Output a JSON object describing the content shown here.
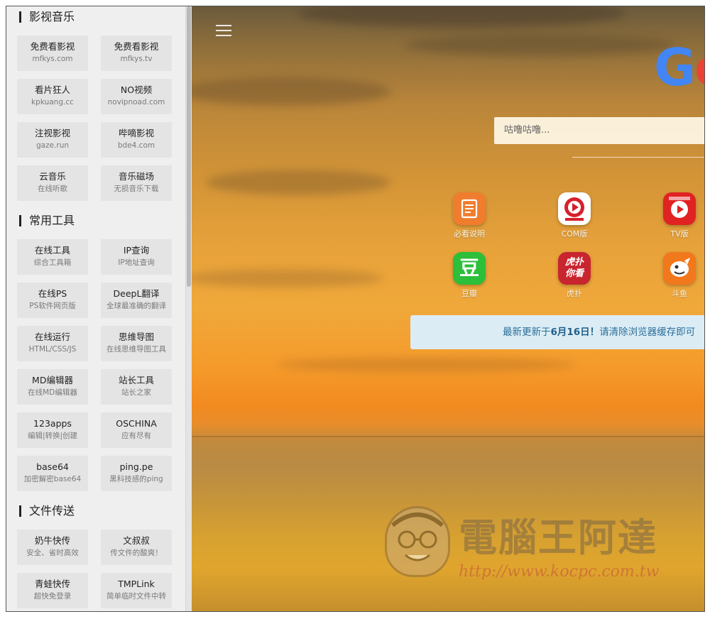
{
  "sidebar": {
    "sections": [
      {
        "title": "影视音乐",
        "items": [
          {
            "name": "免费看影视",
            "sub": "mfkys.com"
          },
          {
            "name": "免费看影视",
            "sub": "mfkys.tv"
          },
          {
            "name": "看片狂人",
            "sub": "kpkuang.cc"
          },
          {
            "name": "NO视频",
            "sub": "novipnoad.com"
          },
          {
            "name": "注视影视",
            "sub": "gaze.run"
          },
          {
            "name": "哔嘀影视",
            "sub": "bde4.com"
          },
          {
            "name": "云音乐",
            "sub": "在线听歌"
          },
          {
            "name": "音乐磁场",
            "sub": "无损音乐下载"
          }
        ]
      },
      {
        "title": "常用工具",
        "items": [
          {
            "name": "在线工具",
            "sub": "综合工具箱"
          },
          {
            "name": "IP查询",
            "sub": "IP地址查询"
          },
          {
            "name": "在线PS",
            "sub": "PS软件网页版"
          },
          {
            "name": "DeepL翻译",
            "sub": "全球最准确的翻译"
          },
          {
            "name": "在线运行",
            "sub": "HTML/CSS/JS"
          },
          {
            "name": "思维导图",
            "sub": "在线思维导图工具"
          },
          {
            "name": "MD编辑器",
            "sub": "在线MD编辑器"
          },
          {
            "name": "站长工具",
            "sub": "站长之家"
          },
          {
            "name": "123apps",
            "sub": "编辑|转换|创建"
          },
          {
            "name": "OSCHINA",
            "sub": "应有尽有"
          },
          {
            "name": "base64",
            "sub": "加密解密base64"
          },
          {
            "name": "ping.pe",
            "sub": "黑科技感的ping"
          }
        ]
      },
      {
        "title": "文件传送",
        "items": [
          {
            "name": "奶牛快传",
            "sub": "安全、省时高效"
          },
          {
            "name": "文叔叔",
            "sub": "传文件的酸爽！"
          },
          {
            "name": "青蛙快传",
            "sub": "超快免登录"
          },
          {
            "name": "TMPLink",
            "sub": "简单临时文件中转"
          }
        ]
      }
    ]
  },
  "main": {
    "logo_text": "Go",
    "search": {
      "placeholder": "咕噜咕噜..."
    },
    "apps": [
      {
        "label": "必看说明",
        "icon": "document-icon",
        "color": "#f07d2e"
      },
      {
        "label": "COM版",
        "icon": "play-badge-icon",
        "color": "#ffffff"
      },
      {
        "label": "TV版",
        "icon": "mfkys-tv-icon",
        "color": "#e02222"
      },
      {
        "label": "豆瓣",
        "icon": "douban-icon",
        "color": "#2bbf3a",
        "glyph": "豆"
      },
      {
        "label": "虎扑",
        "icon": "hupu-icon",
        "color": "#c8252f",
        "glyph": "虎扑\n你看"
      },
      {
        "label": "斗鱼",
        "icon": "douyu-icon",
        "color": "#f2781c"
      }
    ],
    "notice": {
      "prefix": "最新更新于",
      "date": "6月16日！",
      "suffix": "请清除浏览器缓存即可"
    }
  },
  "watermark": {
    "title": "電腦王阿達",
    "url": "http://www.kocpc.com.tw"
  },
  "colors": {
    "sidebar_bg": "#efefef",
    "tile_bg": "#e4e4e4",
    "notice_bg": "#dcecf5",
    "notice_text": "#2a6f9a"
  }
}
